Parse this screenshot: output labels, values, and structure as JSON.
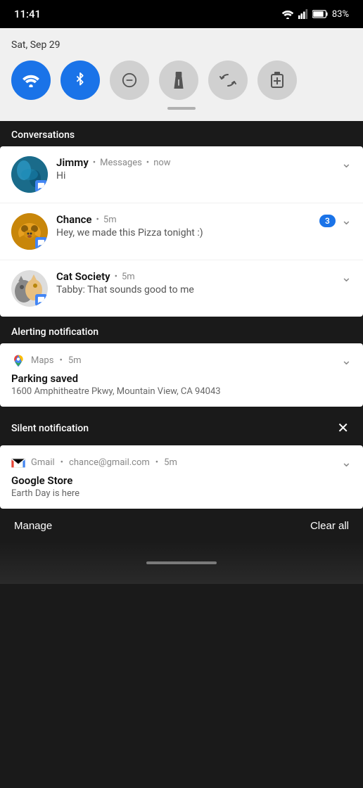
{
  "statusBar": {
    "time": "11:41",
    "battery": "83%"
  },
  "quickSettings": {
    "date": "Sat, Sep 29",
    "toggles": [
      {
        "id": "wifi",
        "icon": "wifi",
        "active": true,
        "label": "Wi-Fi"
      },
      {
        "id": "bluetooth",
        "icon": "bluetooth",
        "active": true,
        "label": "Bluetooth"
      },
      {
        "id": "dnd",
        "icon": "dnd",
        "active": false,
        "label": "Do Not Disturb"
      },
      {
        "id": "flashlight",
        "icon": "torch",
        "active": false,
        "label": "Flashlight"
      },
      {
        "id": "autorotate",
        "icon": "sync",
        "active": false,
        "label": "Auto-rotate"
      },
      {
        "id": "batterysaver",
        "icon": "batt",
        "active": false,
        "label": "Battery Saver"
      }
    ]
  },
  "sections": {
    "conversations": {
      "label": "Conversations",
      "items": [
        {
          "id": "jimmy",
          "name": "Jimmy",
          "app": "Messages",
          "time": "now",
          "message": "Hi",
          "badge": null
        },
        {
          "id": "chance",
          "name": "Chance",
          "app": null,
          "time": "5m",
          "message": "Hey, we made this Pizza tonight :)",
          "badge": "3"
        },
        {
          "id": "catsociety",
          "name": "Cat Society",
          "app": null,
          "time": "5m",
          "message": "Tabby: That sounds good to me",
          "badge": null
        }
      ]
    },
    "alerting": {
      "label": "Alerting notification",
      "items": [
        {
          "id": "maps",
          "app": "Maps",
          "time": "5m",
          "title": "Parking saved",
          "body": "1600 Amphitheatre Pkwy, Mountain View, CA 94043"
        }
      ]
    },
    "silent": {
      "label": "Silent notification",
      "items": [
        {
          "id": "gmail",
          "app": "Gmail",
          "email": "chance@gmail.com",
          "time": "5m",
          "title": "Google Store",
          "body": "Earth Day is here"
        }
      ]
    }
  },
  "bottomBar": {
    "manageLabel": "Manage",
    "clearAllLabel": "Clear all"
  },
  "separatorDot": "•"
}
